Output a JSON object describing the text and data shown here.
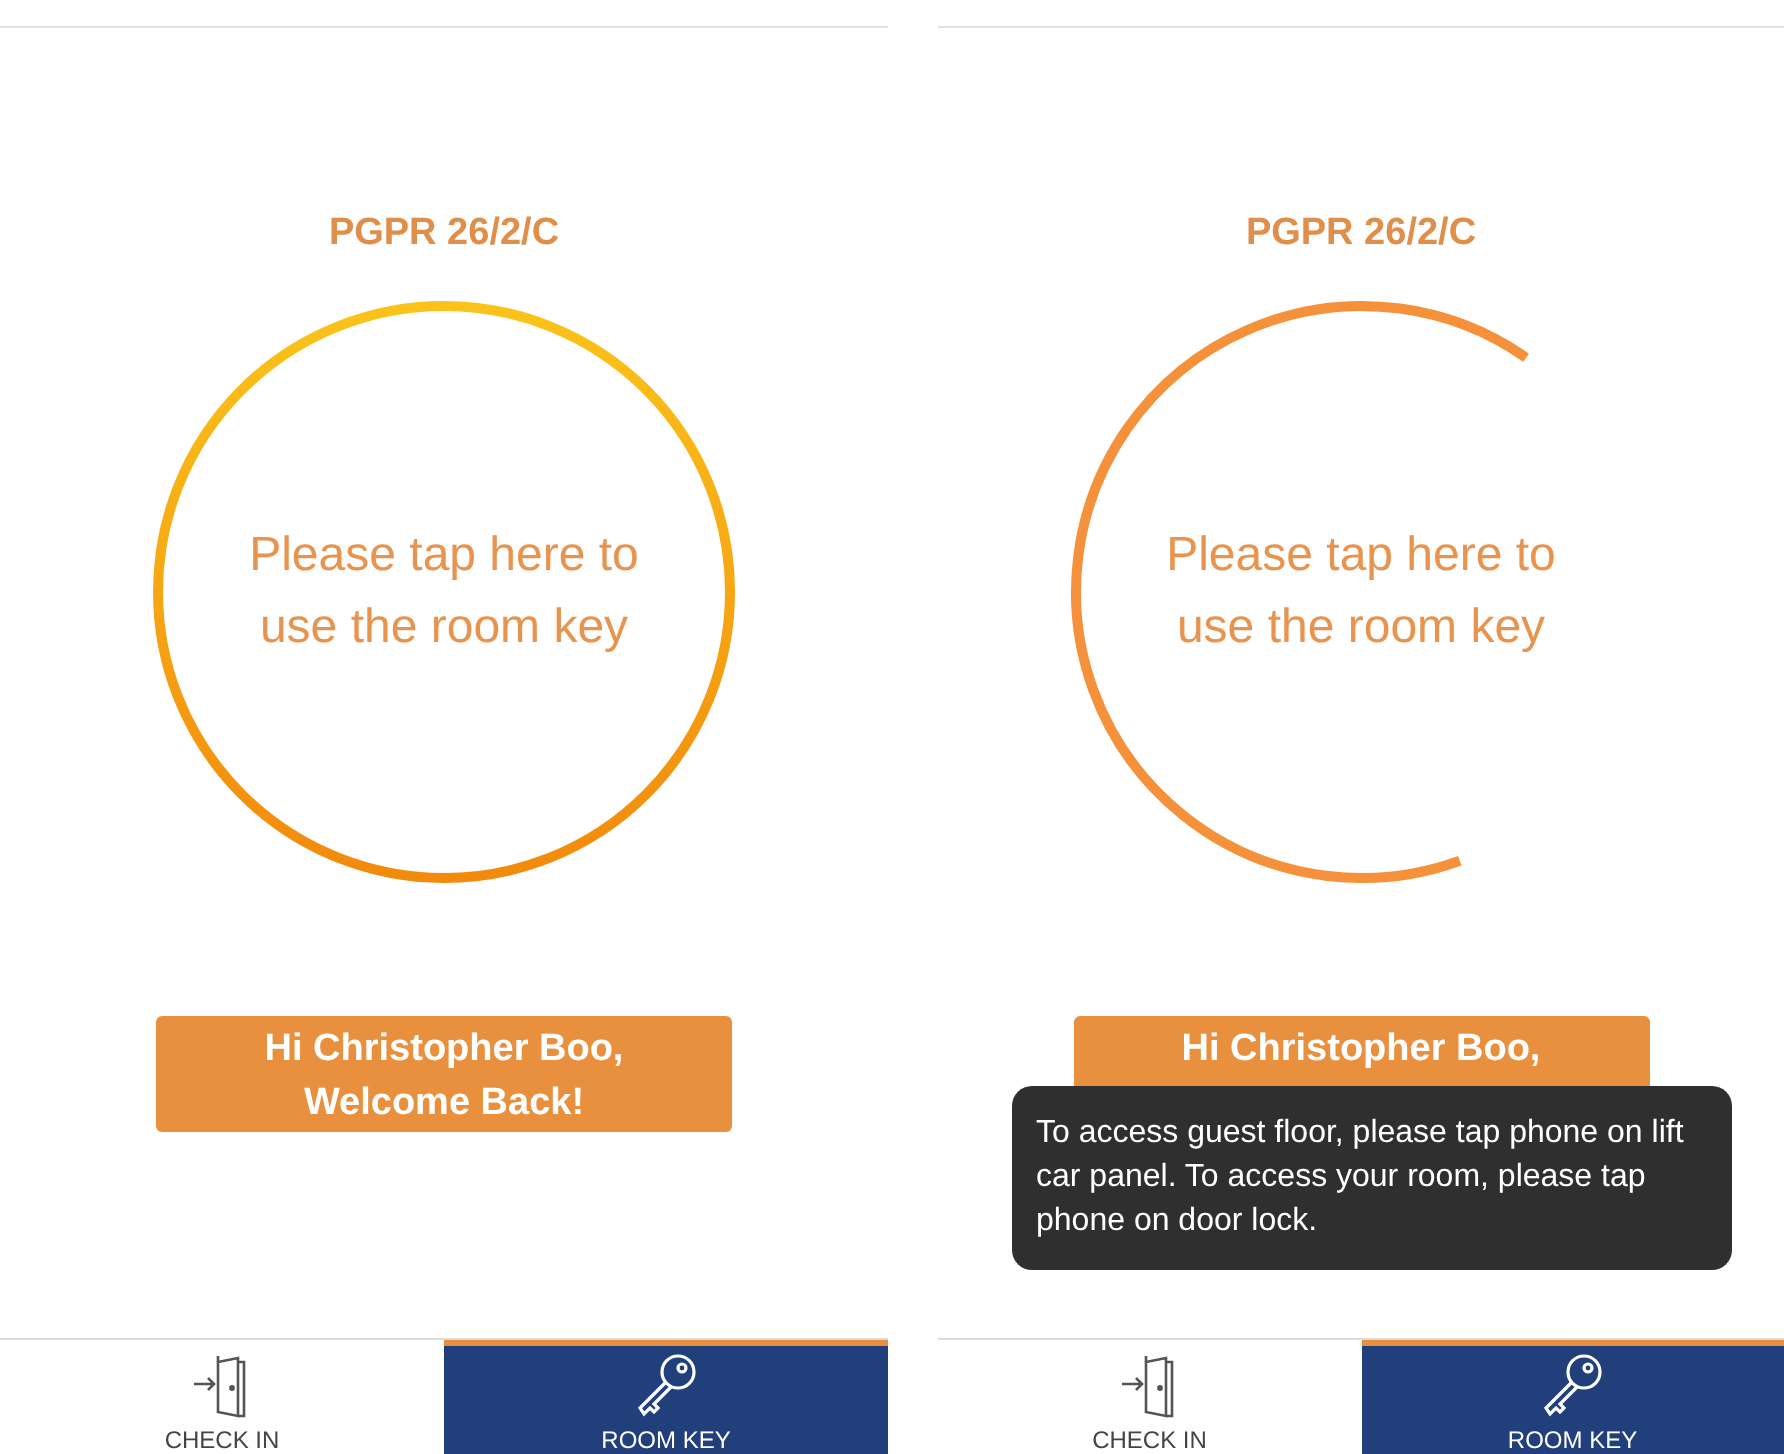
{
  "screens": [
    {
      "room_title": "PGPR 26/2/C",
      "ring": {
        "kind": "full"
      },
      "prompt": "Please tap here to use the room key",
      "welcome": [
        "Hi Christopher Boo,",
        "Welcome Back!"
      ],
      "tabs": [
        {
          "kind": "check_in",
          "label": "CHECK IN",
          "selected": false
        },
        {
          "kind": "room_key",
          "label": "ROOM KEY",
          "selected": true
        }
      ]
    },
    {
      "room_title": "PGPR 26/2/C",
      "ring": {
        "kind": "spinning"
      },
      "prompt": "Please tap here to use the room key",
      "welcome": [
        "Hi Christopher Boo,"
      ],
      "toast": "To access guest floor, please tap phone on lift car panel. To access your room, please tap phone on door lock.",
      "tabs": [
        {
          "kind": "check_in",
          "label": "CHECK IN",
          "selected": false
        },
        {
          "kind": "room_key",
          "label": "ROOM KEY",
          "selected": true
        }
      ]
    }
  ]
}
